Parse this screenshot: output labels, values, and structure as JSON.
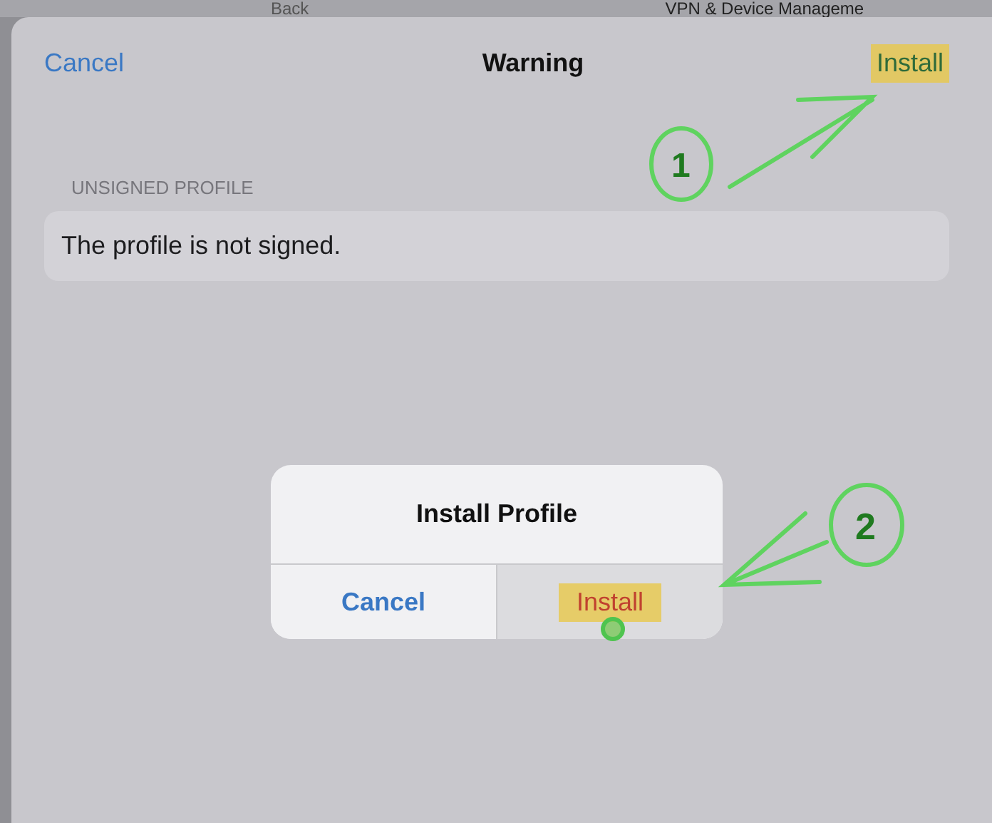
{
  "background": {
    "back_link": "Back",
    "title": "VPN & Device Manageme"
  },
  "sheet": {
    "cancel": "Cancel",
    "title": "Warning",
    "action": "Install",
    "action_highlighted": true,
    "section_header": "UNSIGNED PROFILE",
    "message": "The profile is not signed."
  },
  "alert": {
    "title": "Install Profile",
    "buttons": [
      {
        "label": "Cancel",
        "kind": "default",
        "selected": false,
        "highlighted": false
      },
      {
        "label": "Install",
        "kind": "destructive",
        "selected": true,
        "highlighted": true
      }
    ]
  },
  "annotations": [
    {
      "label": "1"
    },
    {
      "label": "2"
    }
  ]
}
